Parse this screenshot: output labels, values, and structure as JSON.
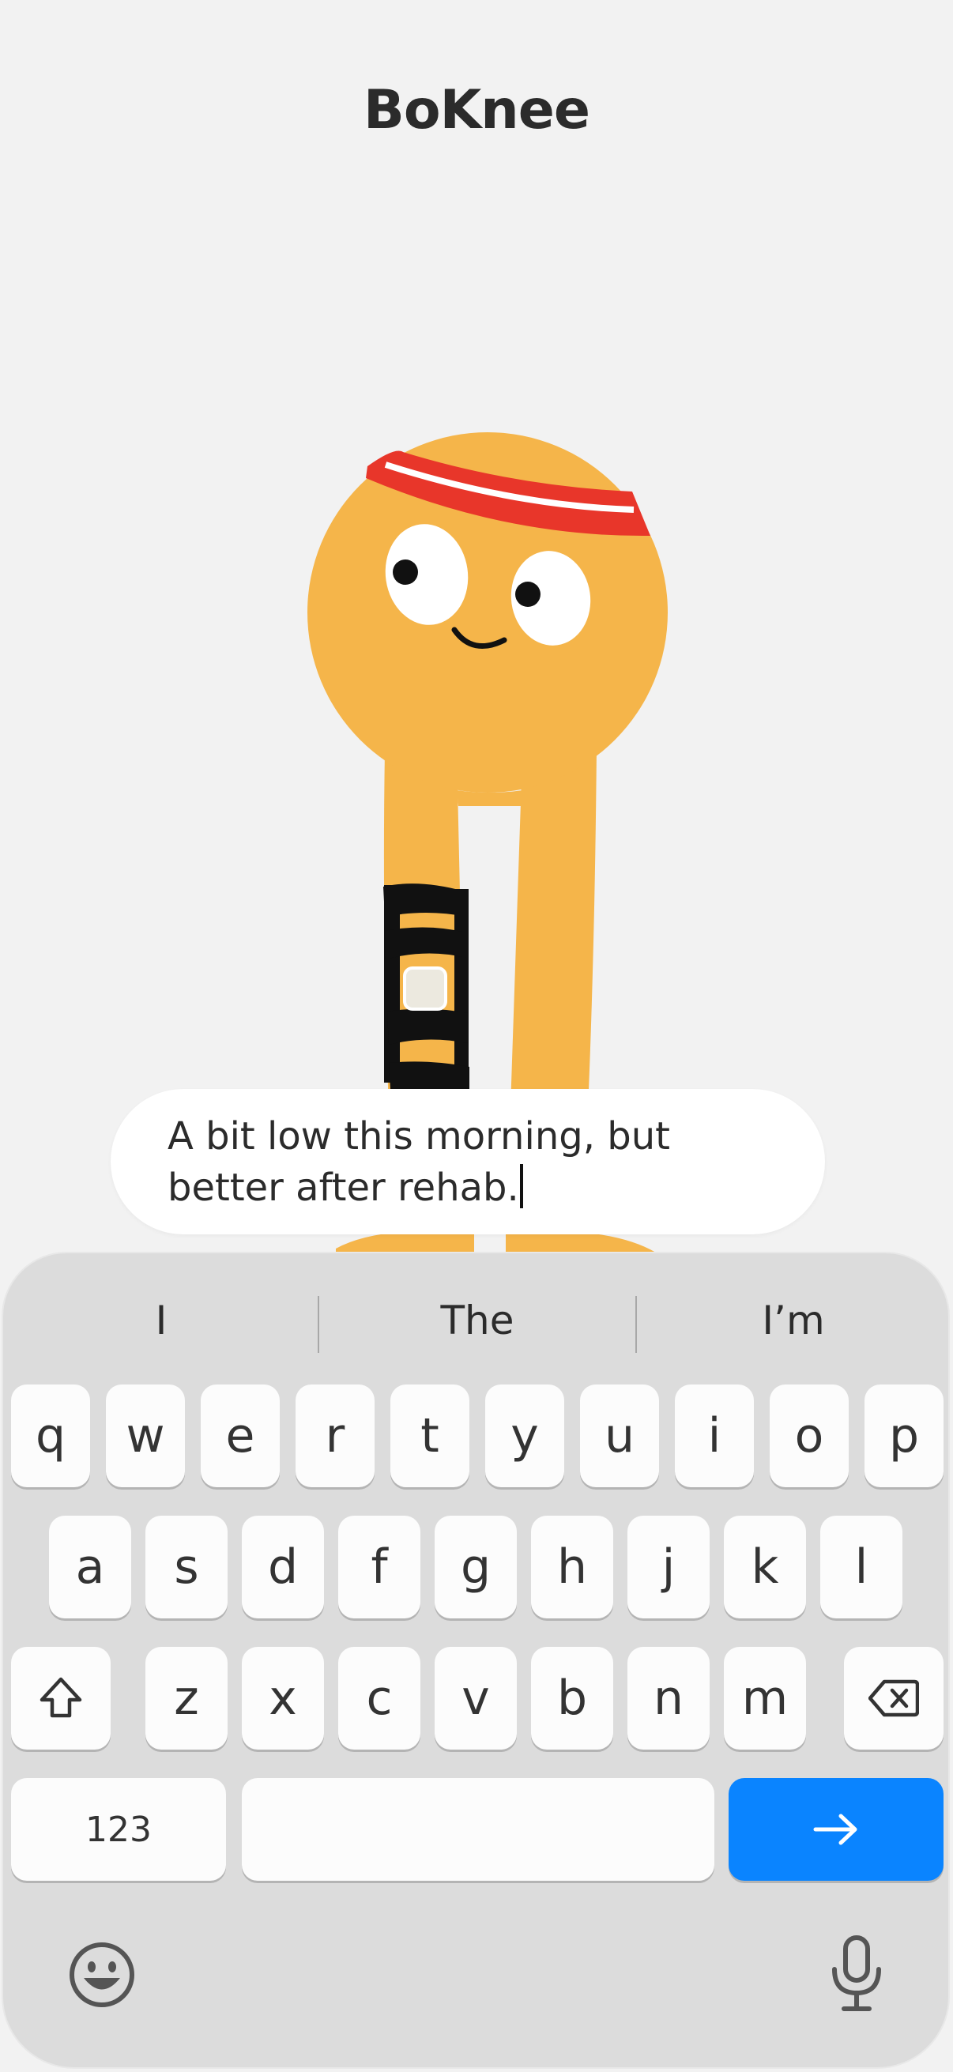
{
  "app": {
    "title": "BoKnee"
  },
  "input": {
    "text": "A bit low this morning, but better after rehab."
  },
  "keyboard": {
    "suggestions": [
      "I",
      "The",
      "I’m"
    ],
    "rows": [
      [
        "q",
        "w",
        "e",
        "r",
        "t",
        "y",
        "u",
        "i",
        "o",
        "p"
      ],
      [
        "a",
        "s",
        "d",
        "f",
        "g",
        "h",
        "j",
        "k",
        "l"
      ],
      [
        "z",
        "x",
        "c",
        "v",
        "b",
        "n",
        "m"
      ]
    ],
    "numbers_label": "123",
    "shift_icon": "shift-icon",
    "delete_icon": "backspace-icon",
    "go_icon": "arrow-right-icon",
    "emoji_icon": "emoji-icon",
    "mic_icon": "microphone-icon"
  },
  "colors": {
    "mascot": "#f5b54a",
    "headband": "#e8362a",
    "go_key": "#0a84ff",
    "background": "#f2f2f2"
  }
}
